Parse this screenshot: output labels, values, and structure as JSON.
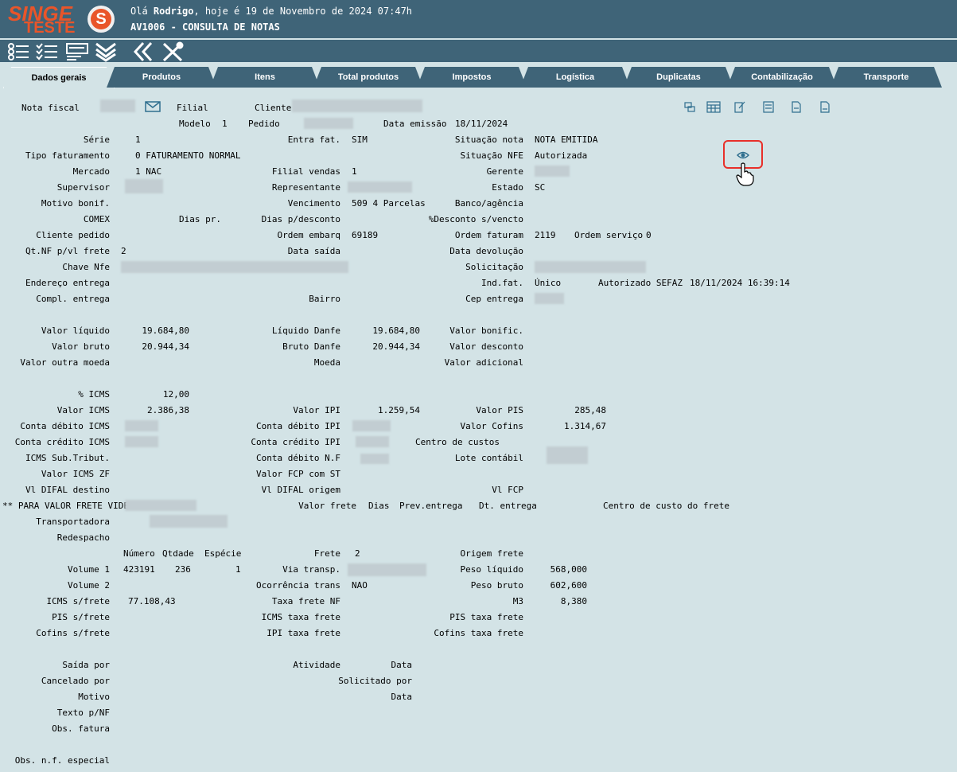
{
  "header": {
    "logo_top": "SINGE",
    "logo_bottom": "TESTE",
    "logo_mark": "S",
    "greeting_prefix": "Olá ",
    "user_name": "Rodrigo",
    "greeting_suffix": ", hoje é 19 de Novembro de 2024 07:47h",
    "screen_title": "AV1006 - CONSULTA DE NOTAS"
  },
  "toolbar": {
    "icons": [
      "list-check-icon",
      "list-check-icon",
      "form-icon",
      "double-chevron-down-icon",
      "double-chevron-left-icon",
      "tools-icon"
    ]
  },
  "tabs": [
    {
      "label": "Dados gerais"
    },
    {
      "label": "Produtos"
    },
    {
      "label": "Itens"
    },
    {
      "label": "Total produtos"
    },
    {
      "label": "Impostos"
    },
    {
      "label": "Logística"
    },
    {
      "label": "Duplicatas"
    },
    {
      "label": "Contabilização"
    },
    {
      "label": "Transporte"
    }
  ],
  "form": {
    "nota_fiscal": "Nota fiscal",
    "filial": "Filial",
    "cliente": "Cliente",
    "modelo": "Modelo",
    "modelo_val": "1",
    "pedido": "Pedido",
    "data_emissao": "Data emissão",
    "data_emissao_val": "18/11/2024",
    "serie": "Série",
    "serie_val": "1",
    "entra_fat": "Entra fat.",
    "entra_fat_val": "SIM",
    "situacao_nota": "Situação nota",
    "situacao_nota_val": "NOTA EMITIDA",
    "tipo_faturamento": "Tipo faturamento",
    "tipo_faturamento_val": "0 FATURAMENTO NORMAL",
    "situacao_nfe": "Situação NFE",
    "situacao_nfe_val": "Autorizada",
    "mercado": "Mercado",
    "mercado_val": "1 NAC",
    "filial_vendas": "Filial vendas",
    "filial_vendas_val": "1",
    "gerente": "Gerente",
    "supervisor": "Supervisor",
    "representante": "Representante",
    "estado": "Estado",
    "estado_val": "SC",
    "motivo_bonif": "Motivo bonif.",
    "vencimento": "Vencimento",
    "vencimento_val": "509 4 Parcelas",
    "banco_agencia": "Banco/agência",
    "comex": "COMEX",
    "dias_pr": "Dias pr.",
    "dias_desconto": "Dias p/desconto",
    "desconto_vencto": "%Desconto s/vencto",
    "cliente_pedido": "Cliente pedido",
    "ordem_embarq": "Ordem embarq",
    "ordem_embarq_val": "69189",
    "ordem_faturam": "Ordem faturam",
    "ordem_faturam_val": "2119",
    "ordem_servico": "Ordem serviço",
    "ordem_servico_val": "0",
    "qt_nf_frete": "Qt.NF p/vl frete",
    "qt_nf_frete_val": "2",
    "data_saida": "Data saída",
    "data_devolucao": "Data devolução",
    "chave_nfe": "Chave Nfe",
    "solicitacao": "Solicitação",
    "endereco_entrega": "Endereço entrega",
    "ind_fat": "Ind.fat.",
    "ind_fat_val": "Único",
    "autorizado_sefaz": "Autorizado SEFAZ",
    "autorizado_sefaz_val": "18/11/2024 16:39:14",
    "compl_entrega": "Compl. entrega",
    "bairro": "Bairro",
    "cep_entrega": "Cep entrega",
    "valor_liquido": "Valor líquido",
    "valor_liquido_val": "19.684,80",
    "liquido_danfe": "Líquido Danfe",
    "liquido_danfe_val": "19.684,80",
    "valor_bonific": "Valor bonific.",
    "valor_bruto": "Valor bruto",
    "valor_bruto_val": "20.944,34",
    "bruto_danfe": "Bruto Danfe",
    "bruto_danfe_val": "20.944,34",
    "valor_desconto": "Valor desconto",
    "valor_outra_moeda": "Valor outra moeda",
    "moeda": "Moeda",
    "valor_adicional": "Valor adicional",
    "pct_icms": "% ICMS",
    "pct_icms_val": "12,00",
    "valor_icms": "Valor ICMS",
    "valor_icms_val": "2.386,38",
    "valor_ipi": "Valor IPI",
    "valor_ipi_val": "1.259,54",
    "valor_pis": "Valor PIS",
    "valor_pis_val": "285,48",
    "conta_debito_icms": "Conta débito ICMS",
    "conta_debito_ipi": "Conta débito IPI",
    "valor_cofins": "Valor Cofins",
    "valor_cofins_val": "1.314,67",
    "conta_credito_icms": "Conta crédito ICMS",
    "conta_credito_ipi": "Conta crédito IPI",
    "centro_custos": "Centro de custos",
    "icms_sub_tribut": "ICMS Sub.Tribut.",
    "conta_debito_nf": "Conta débito N.F",
    "lote_contabil": "Lote contábil",
    "valor_icms_zf": "Valor ICMS ZF",
    "valor_fcp_st": "Valor FCP com ST",
    "vl_difal_destino": "Vl DIFAL destino",
    "vl_difal_origem": "Vl DIFAL origem",
    "vl_fcp": "Vl FCP",
    "para_valor_frete": "** PARA VALOR FRETE VIDE",
    "valor_frete": "Valor frete",
    "dias": "Dias",
    "prev_entrega": "Prev.entrega",
    "dt_entrega": "Dt. entrega",
    "centro_custo_frete": "Centro de custo do frete",
    "transportadora": "Transportadora",
    "redespacho": "Redespacho",
    "numero": "Número",
    "qtdade": "Qtdade",
    "especie": "Espécie",
    "frete": "Frete",
    "frete_val": "2",
    "origem_frete": "Origem frete",
    "volume1": "Volume 1",
    "volume1_numero": "423191",
    "volume1_qtdade": "236",
    "volume1_especie": "1",
    "via_transp": "Via transp.",
    "peso_liquido": "Peso líquido",
    "peso_liquido_val": "568,000",
    "volume2": "Volume 2",
    "ocorrencia_trans": "Ocorrência trans",
    "ocorrencia_trans_val": "NAO",
    "peso_bruto": "Peso bruto",
    "peso_bruto_val": "602,600",
    "icms_s_frete": "ICMS s/frete",
    "icms_s_frete_val": "77.108,43",
    "taxa_frete_nf": "Taxa frete NF",
    "m3": "M3",
    "m3_val": "8,380",
    "pis_s_frete": "PIS s/frete",
    "icms_taxa_frete": "ICMS taxa frete",
    "pis_taxa_frete": "PIS taxa frete",
    "cofins_s_frete": "Cofins s/frete",
    "ipi_taxa_frete": "IPI taxa frete",
    "cofins_taxa_frete": "Cofins taxa frete",
    "saida_por": "Saída por",
    "atividade": "Atividade",
    "data": "Data",
    "cancelado_por": "Cancelado por",
    "solicitado_por": "Solicitado por",
    "motivo": "Motivo",
    "texto_nf": "Texto p/NF",
    "obs_fatura": "Obs. fatura",
    "obs_nf_especial": "Obs. n.f. especial"
  },
  "colors": {
    "header_bg": "#3f6478",
    "content_bg": "#d3e3e6",
    "logo": "#e9552a",
    "highlight": "#e8302a"
  }
}
